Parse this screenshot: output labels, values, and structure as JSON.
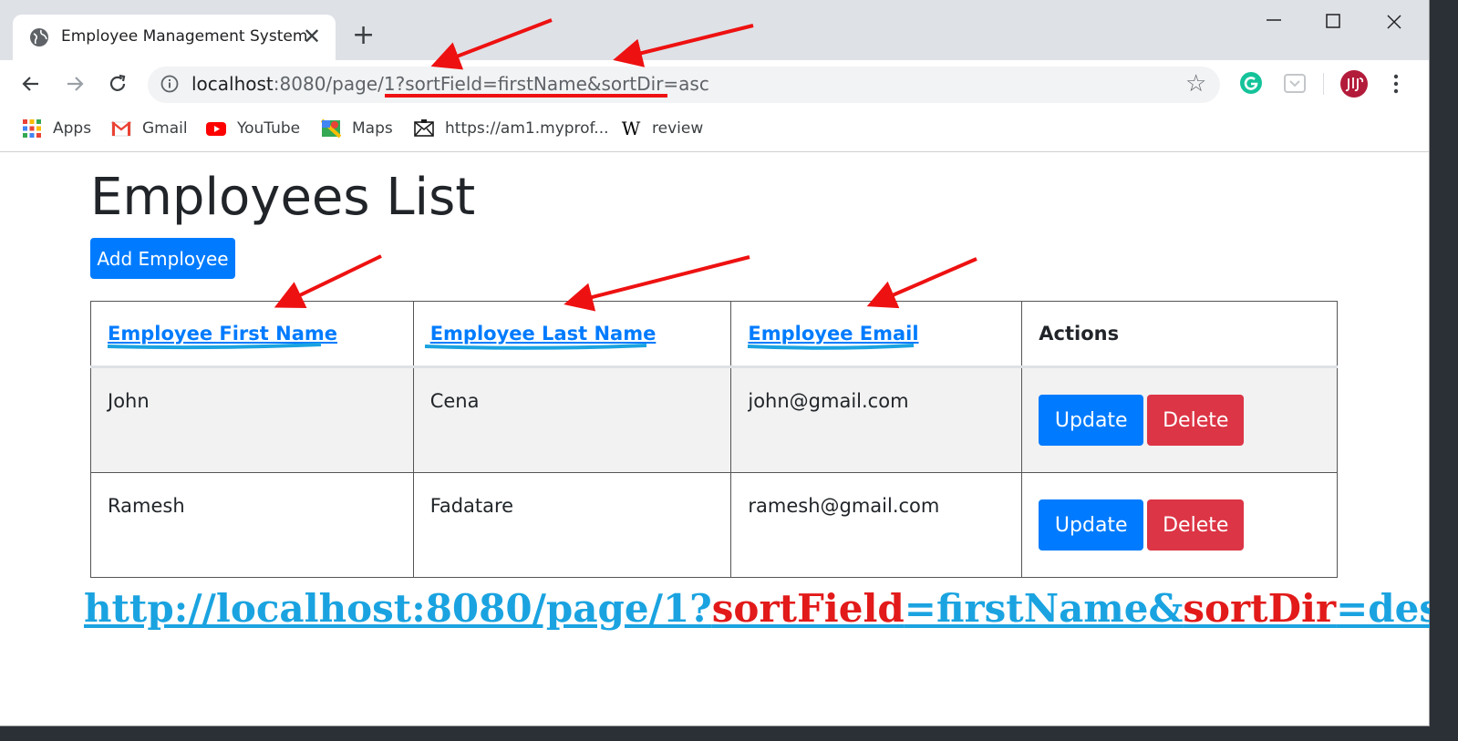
{
  "browser": {
    "tab_title": "Employee Management System",
    "tab_close": "✕",
    "new_tab": "+",
    "url_host": "localhost",
    "url_rest_plain": ":8080/page/1?",
    "url_query": "sortField=firstName&sortDir=asc",
    "bookmarks": [
      {
        "label": "Apps",
        "icon": "apps-grid-icon"
      },
      {
        "label": "Gmail",
        "icon": "gmail-icon"
      },
      {
        "label": "YouTube",
        "icon": "youtube-icon"
      },
      {
        "label": "Maps",
        "icon": "maps-icon"
      },
      {
        "label": "https://am1.myprof...",
        "icon": "mail-envelope-icon"
      },
      {
        "label": "review",
        "icon": "wikipedia-icon"
      }
    ]
  },
  "page": {
    "title": "Employees List",
    "add_button": "Add Employee",
    "table": {
      "headers": [
        "Employee First Name",
        "Employee Last Name",
        "Employee Email",
        "Actions"
      ],
      "rows": [
        {
          "first": "John",
          "last": "Cena",
          "email": "john@gmail.com"
        },
        {
          "first": "Ramesh",
          "last": "Fadatare",
          "email": "ramesh@gmail.com"
        }
      ],
      "update_label": "Update",
      "delete_label": "Delete"
    },
    "annotation_url": {
      "part1": "http://localhost:8080/page/1?",
      "part2": "sortField",
      "part3": "=firstName&",
      "part4": "sortDir",
      "part5": "=desc"
    }
  },
  "colors": {
    "primary": "#007bff",
    "danger": "#dc3545",
    "annotation_red": "#e21a1a",
    "annotation_blue": "#1aa3e0"
  }
}
